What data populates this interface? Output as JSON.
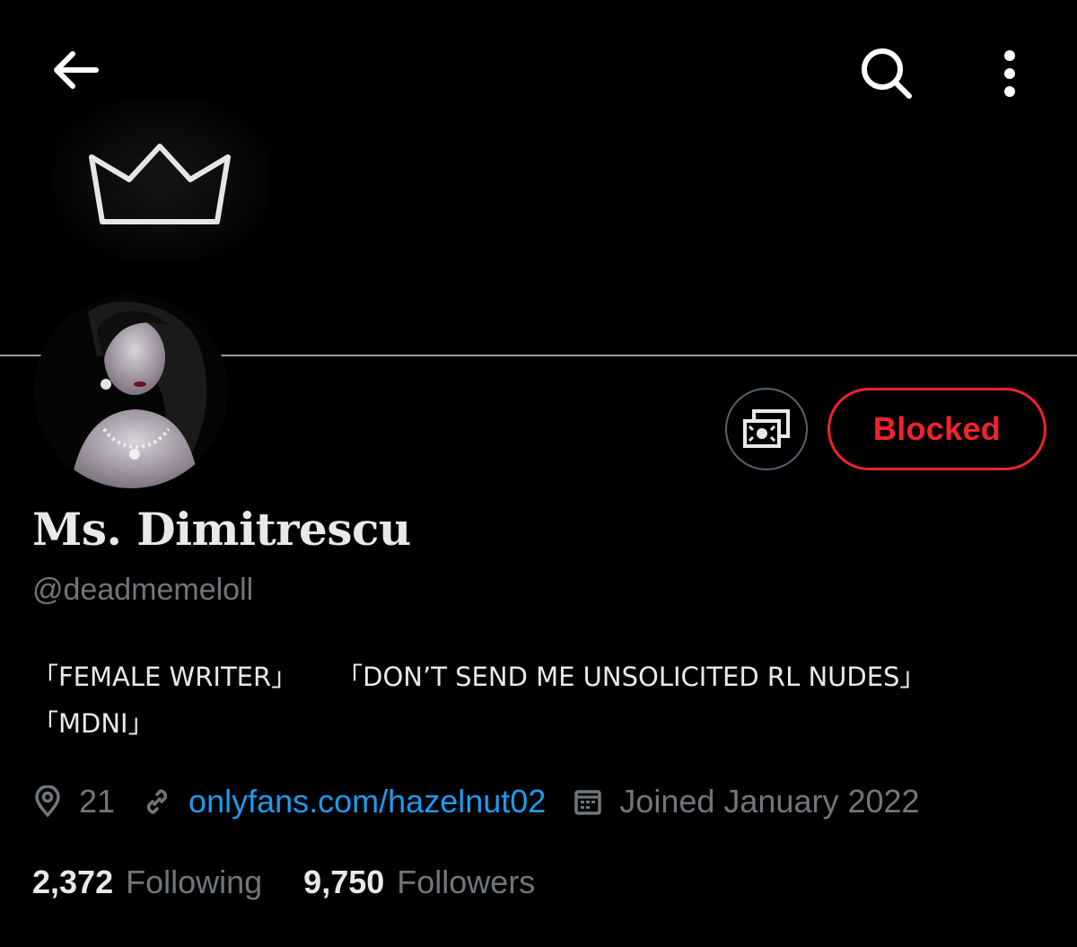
{
  "profile": {
    "display_name": "Ms. Dimitrescu",
    "handle": "@deadmemeloll",
    "bio": {
      "line1_a": "「FEMALE WRITER」",
      "line1_b": "「DON’T SEND ME UNSOLICITED RL NUDES」",
      "line2": "「MDNI」"
    },
    "location": "21",
    "website": "onlyfans.com/hazelnut02",
    "joined": "Joined January 2022",
    "following_count": "2,372",
    "following_label": "Following",
    "followers_count": "9,750",
    "followers_label": "Followers"
  },
  "actions": {
    "blocked_label": "Blocked"
  },
  "icons": {
    "back": "arrow-left-icon",
    "search": "search-icon",
    "more": "more-vertical-icon",
    "tip": "money-icon",
    "location": "location-pin-icon",
    "link": "link-icon",
    "calendar": "calendar-icon",
    "banner": "crown-icon"
  },
  "colors": {
    "background": "#000000",
    "text_primary": "#e7e9ea",
    "text_secondary": "#71767b",
    "link": "#1d9bf0",
    "blocked": "#f4212e"
  }
}
